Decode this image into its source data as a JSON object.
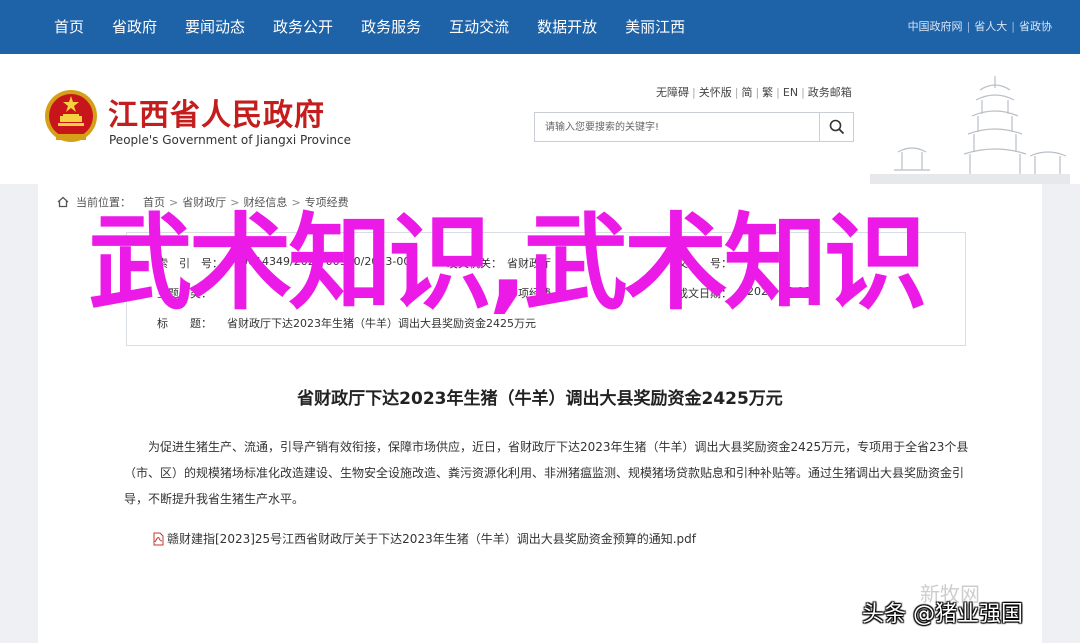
{
  "topnav": {
    "items": [
      "首页",
      "省政府",
      "要闻动态",
      "政务公开",
      "政务服务",
      "互动交流",
      "数据开放",
      "美丽江西"
    ],
    "external_links": [
      "中国政府网",
      "省人大",
      "省政协"
    ]
  },
  "header": {
    "title_cn": "江西省人民政府",
    "title_en": "People's Government of Jiangxi Province",
    "util_links": [
      "无障碍",
      "关怀版",
      "简",
      "繁",
      "EN",
      "政务邮箱"
    ],
    "search_placeholder": "请输入您要搜索的关键字!"
  },
  "breadcrumb": {
    "label": "当前位置：",
    "items": [
      "首页",
      "省财政厅",
      "财经信息",
      "专项经费"
    ]
  },
  "meta": {
    "index_label": "索　引　号：",
    "index_value": "000014349/2023-00970/2023-003",
    "issuer_label": "发文机关：",
    "issuer_value": "省财政厅",
    "category_label": "主题分类：",
    "category_value": "专项经费",
    "date_label": "成文日期：",
    "date_value": "2023-05-09",
    "title_label": "标　　题：",
    "title_value": "省财政厅下达2023年生猪（牛羊）调出大县奖励资金2425万元",
    "docno_label": "文　　号：",
    "docno_value": ""
  },
  "article": {
    "title": "省财政厅下达2023年生猪（牛羊）调出大县奖励资金2425万元",
    "body": "为促进生猪生产、流通，引导产销有效衔接，保障市场供应，近日，省财政厅下达2023年生猪（牛羊）调出大县奖励资金2425万元，专项用于全省23个县（市、区）的规模猪场标准化改造建设、生物安全设施改造、粪污资源化利用、非洲猪瘟监测、规模猪场贷款贴息和引种补贴等。通过生猪调出大县奖励资金引导，不断提升我省生猪生产水平。",
    "attachment": "赣财建指[2023]25号江西省财政厅关于下达2023年生猪（牛羊）调出大县奖励资金预算的通知.pdf"
  },
  "overlay_text": "武术知识,武术知识",
  "watermarks": {
    "faint": "新牧网",
    "main": "头条 @猪业强国"
  },
  "colors": {
    "nav_bg": "#1e62a8",
    "title_red": "#c31d1d",
    "overlay_magenta": "#ec1ae6"
  }
}
